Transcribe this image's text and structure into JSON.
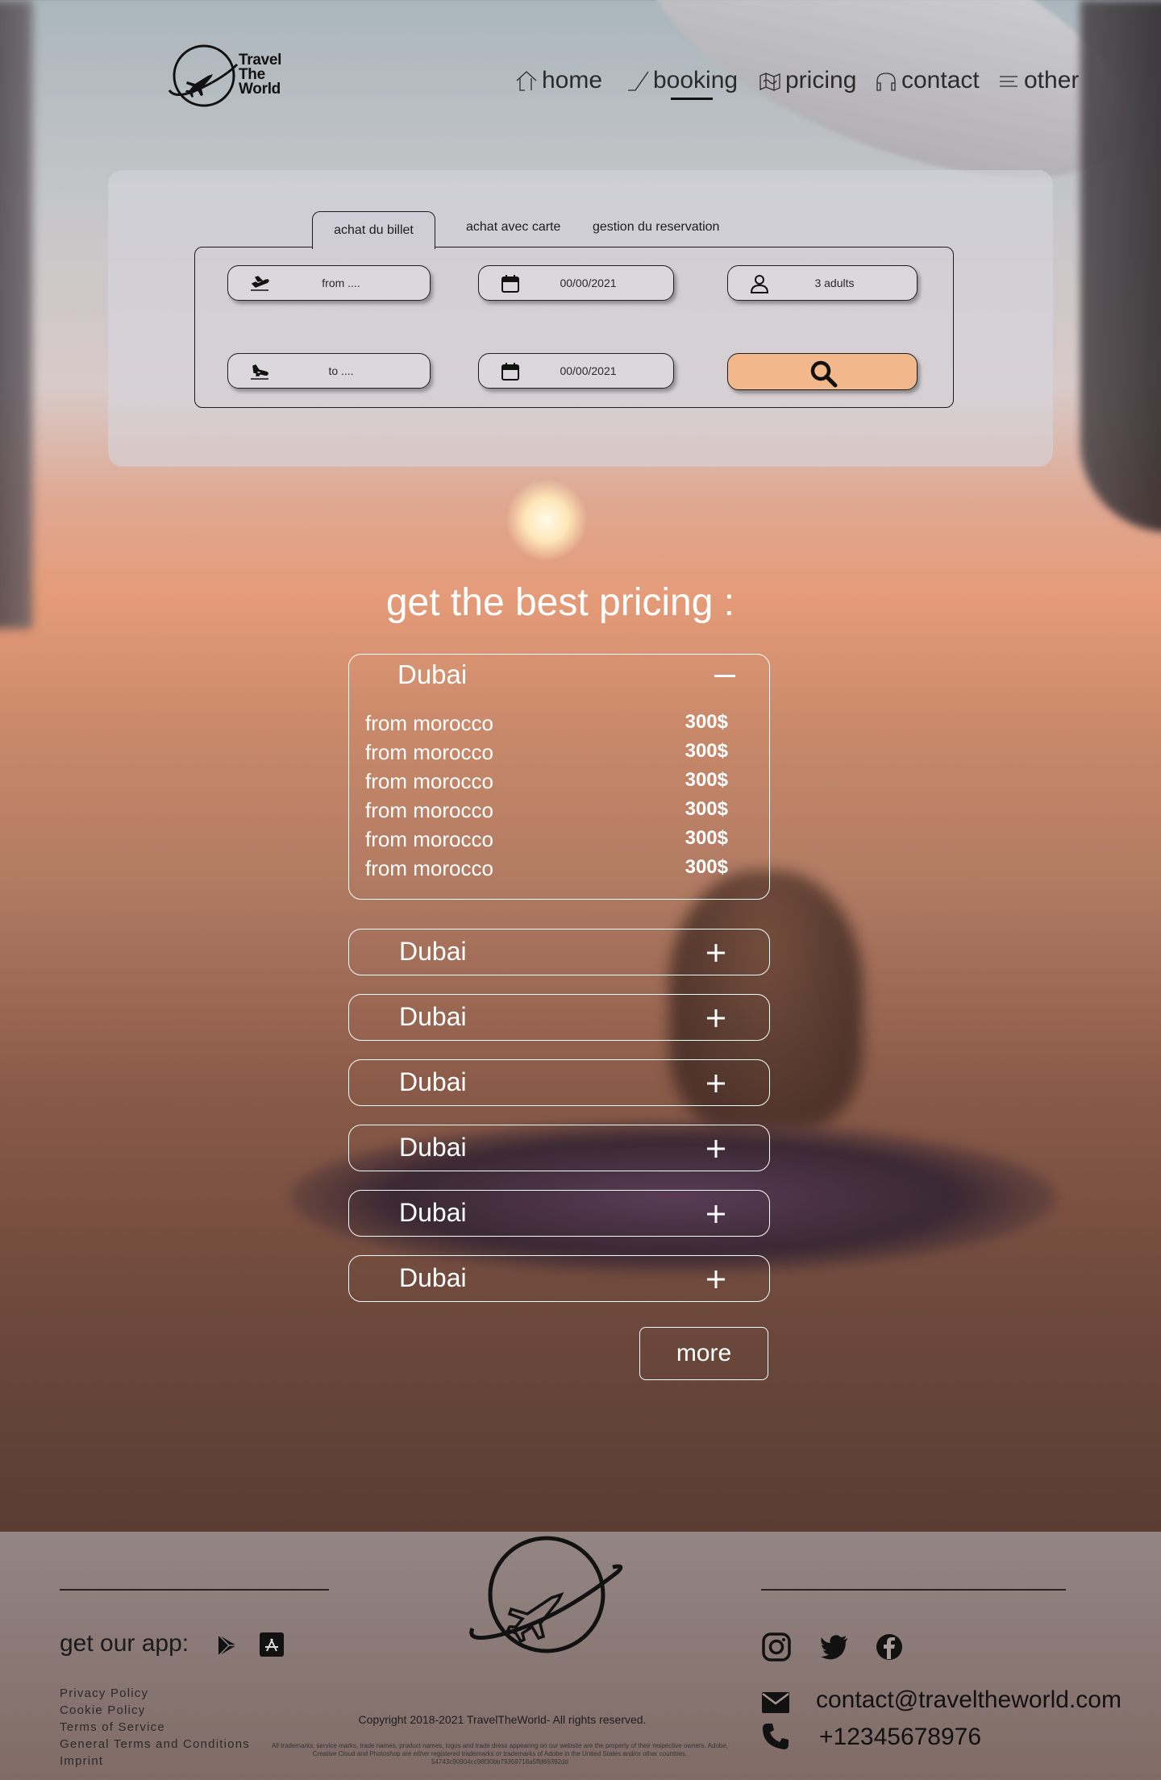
{
  "brand": {
    "name_line1": "Travel",
    "name_line2": "The",
    "name_line3": "World"
  },
  "nav": [
    {
      "label": "home",
      "icon": "home-icon"
    },
    {
      "label": "booking",
      "icon": "check-icon"
    },
    {
      "label": "pricing",
      "icon": "map-icon"
    },
    {
      "label": "contact",
      "icon": "headset-icon"
    },
    {
      "label": "other",
      "icon": "menu-icon"
    }
  ],
  "booking": {
    "tabs": [
      "achat du billet",
      "achat avec carte",
      "gestion du reservation"
    ],
    "from_placeholder": "from ....",
    "to_placeholder": "to ....",
    "depart_date": "00/00/2021",
    "return_date": "00/00/2021",
    "passengers": "3 adults"
  },
  "pricing": {
    "title": "get the best pricing :",
    "open_destination": "Dubai",
    "rows": [
      {
        "from": "from morocco",
        "price": "300$"
      },
      {
        "from": "from morocco",
        "price": "300$"
      },
      {
        "from": "from morocco",
        "price": "300$"
      },
      {
        "from": "from morocco",
        "price": "300$"
      },
      {
        "from": "from morocco",
        "price": "300$"
      },
      {
        "from": "from morocco",
        "price": "300$"
      }
    ],
    "collapsed": [
      "Dubai",
      "Dubai",
      "Dubai",
      "Dubai",
      "Dubai",
      "Dubai"
    ],
    "more_label": "more"
  },
  "footer": {
    "app_label": "get our app:",
    "links": [
      "Privacy Policy",
      "Cookie Policy",
      "Terms of Service",
      "General Terms and Conditions",
      "Imprint"
    ],
    "copyright": "Copyright 2018-2021 TravelTheWorld- All rights reserved.",
    "legal": "All trademarks, service marks, trade names, product names, logos and trade dress appearing on our website are the property of their respective owners. Adobe, Creative Cloud and Photoshop are either registered trademarks or trademarks of Adobe in the United States and/or other countries. 54743c90904cc98f30bb79359718a5ffd69392dd",
    "email": "contact@traveltheworld.com",
    "phone": "+12345678976"
  },
  "colors": {
    "search_button": "#f2b88c",
    "text_light": "#ffffff",
    "text_dark": "#1a1a1a"
  }
}
